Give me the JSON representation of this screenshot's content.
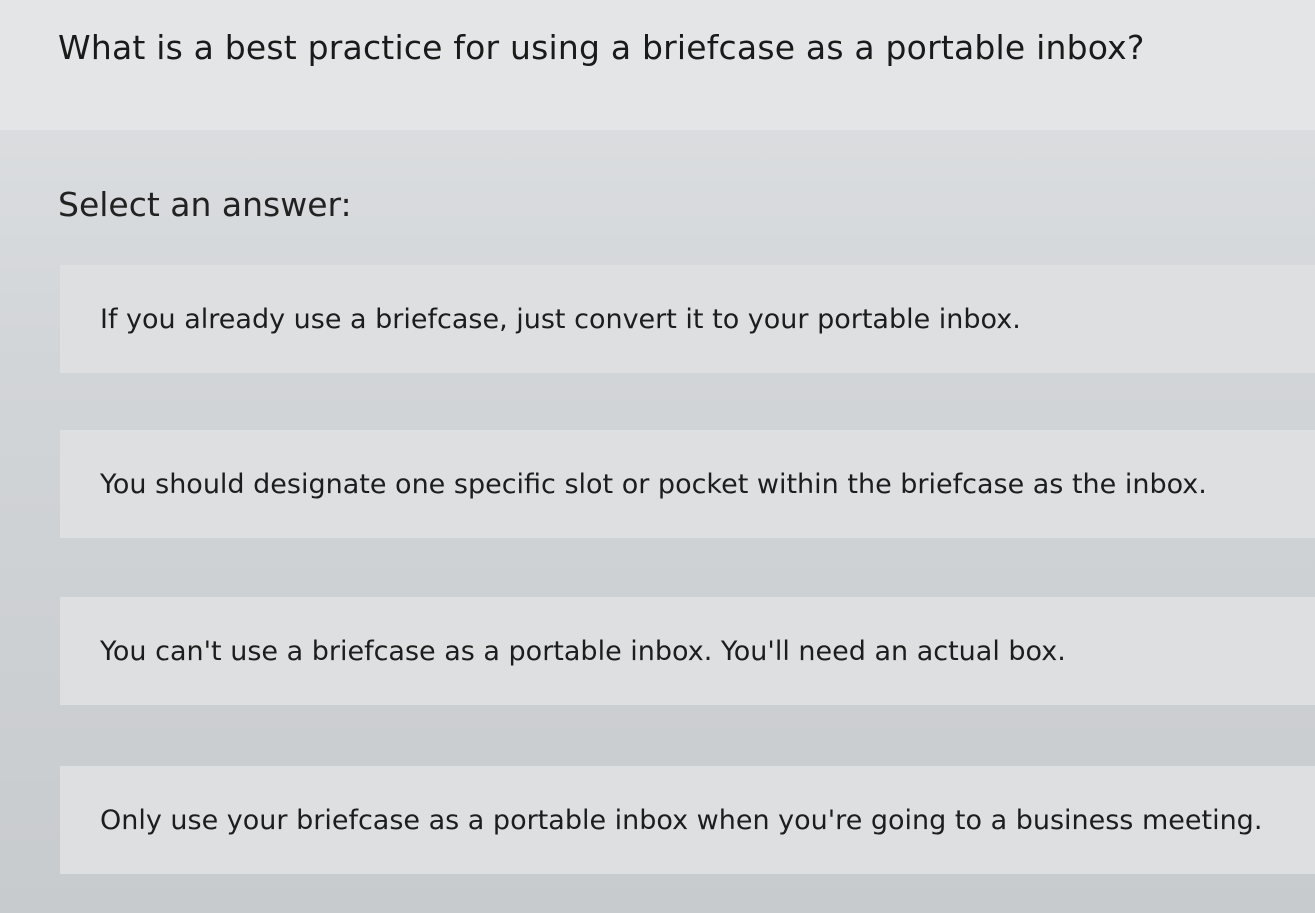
{
  "question": {
    "text": "What is a best practice for using a briefcase as a portable inbox?"
  },
  "prompt": {
    "label": "Select an answer:"
  },
  "options": [
    {
      "label": "If you already use a briefcase, just convert it to your portable inbox."
    },
    {
      "label": "You should designate one specific slot or pocket within the briefcase as the inbox."
    },
    {
      "label": "You can't use a briefcase as a portable inbox. You'll need an actual box."
    },
    {
      "label": "Only use your briefcase as a portable inbox when you're going to a business meeting."
    }
  ]
}
